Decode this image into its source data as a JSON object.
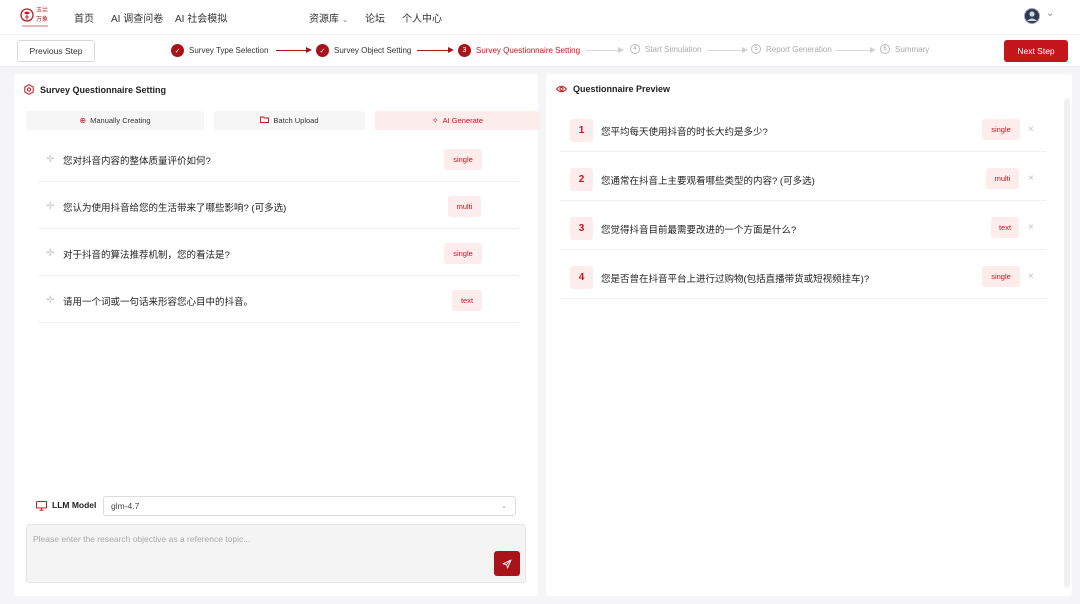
{
  "nav": {
    "logo_text": "玉兰万象",
    "items": [
      "首页",
      "AI 调查问卷",
      "AI 社会模拟",
      "资源库",
      "论坛",
      "个人中心"
    ],
    "resource_caret": "⌄",
    "avatar_caret": "⌄"
  },
  "steps": {
    "prev_label": "Previous Step",
    "next_label": "Next Step",
    "items": [
      {
        "num": "1",
        "label": "Survey Type Selection",
        "status": "done"
      },
      {
        "num": "2",
        "label": "Survey Object Setting",
        "status": "done"
      },
      {
        "num": "3",
        "label": "Survey Questionnaire Setting",
        "status": "active"
      },
      {
        "num": "4",
        "label": "Start Simulation",
        "status": "todo"
      },
      {
        "num": "5",
        "label": "Report Generation",
        "status": "todo"
      },
      {
        "num": "6",
        "label": "Summary",
        "status": "todo"
      }
    ],
    "check_glyph": "✓"
  },
  "left_panel": {
    "title": "Survey Questionnaire Setting",
    "tabs": [
      {
        "label": "Manually Creating",
        "icon": "plus-circle-icon",
        "glyph": "⊕",
        "active": false
      },
      {
        "label": "Batch Upload",
        "icon": "folder-icon",
        "glyph": "▭",
        "active": false
      },
      {
        "label": "AI Generate",
        "icon": "sparkle-icon",
        "glyph": "✧",
        "active": true
      }
    ],
    "drag_glyph": "✛",
    "questions": [
      {
        "text": "您对抖音内容的整体质量评价如何?",
        "type": "single"
      },
      {
        "text": "您认为使用抖音给您的生活带来了哪些影响? (可多选)",
        "type": "multi"
      },
      {
        "text": "对于抖音的算法推荐机制，您的看法是?",
        "type": "single"
      },
      {
        "text": "请用一个词或一句话来形容您心目中的抖音。",
        "type": "text"
      }
    ],
    "llm_label": "LLM Model",
    "llm_value": "glm-4.7",
    "llm_caret": "⌄",
    "prompt_placeholder": "Please enter the research objective as a reference topic..."
  },
  "right_panel": {
    "title": "Questionnaire Preview",
    "close_glyph": "×",
    "questions": [
      {
        "num": "1",
        "text": "您平均每天使用抖音的时长大约是多少?",
        "type": "single"
      },
      {
        "num": "2",
        "text": "您通常在抖音上主要观看哪些类型的内容? (可多选)",
        "type": "multi"
      },
      {
        "num": "3",
        "text": "您觉得抖音目前最需要改进的一个方面是什么?",
        "type": "text"
      },
      {
        "num": "4",
        "text": "您是否曾在抖音平台上进行过购物(包括直播带货或短视频挂车)?",
        "type": "single"
      }
    ]
  },
  "colors": {
    "accent": "#c4161c",
    "accent_dark": "#a8141a",
    "tag_bg": "#fcecec",
    "page_bg": "#f5f5f7"
  }
}
